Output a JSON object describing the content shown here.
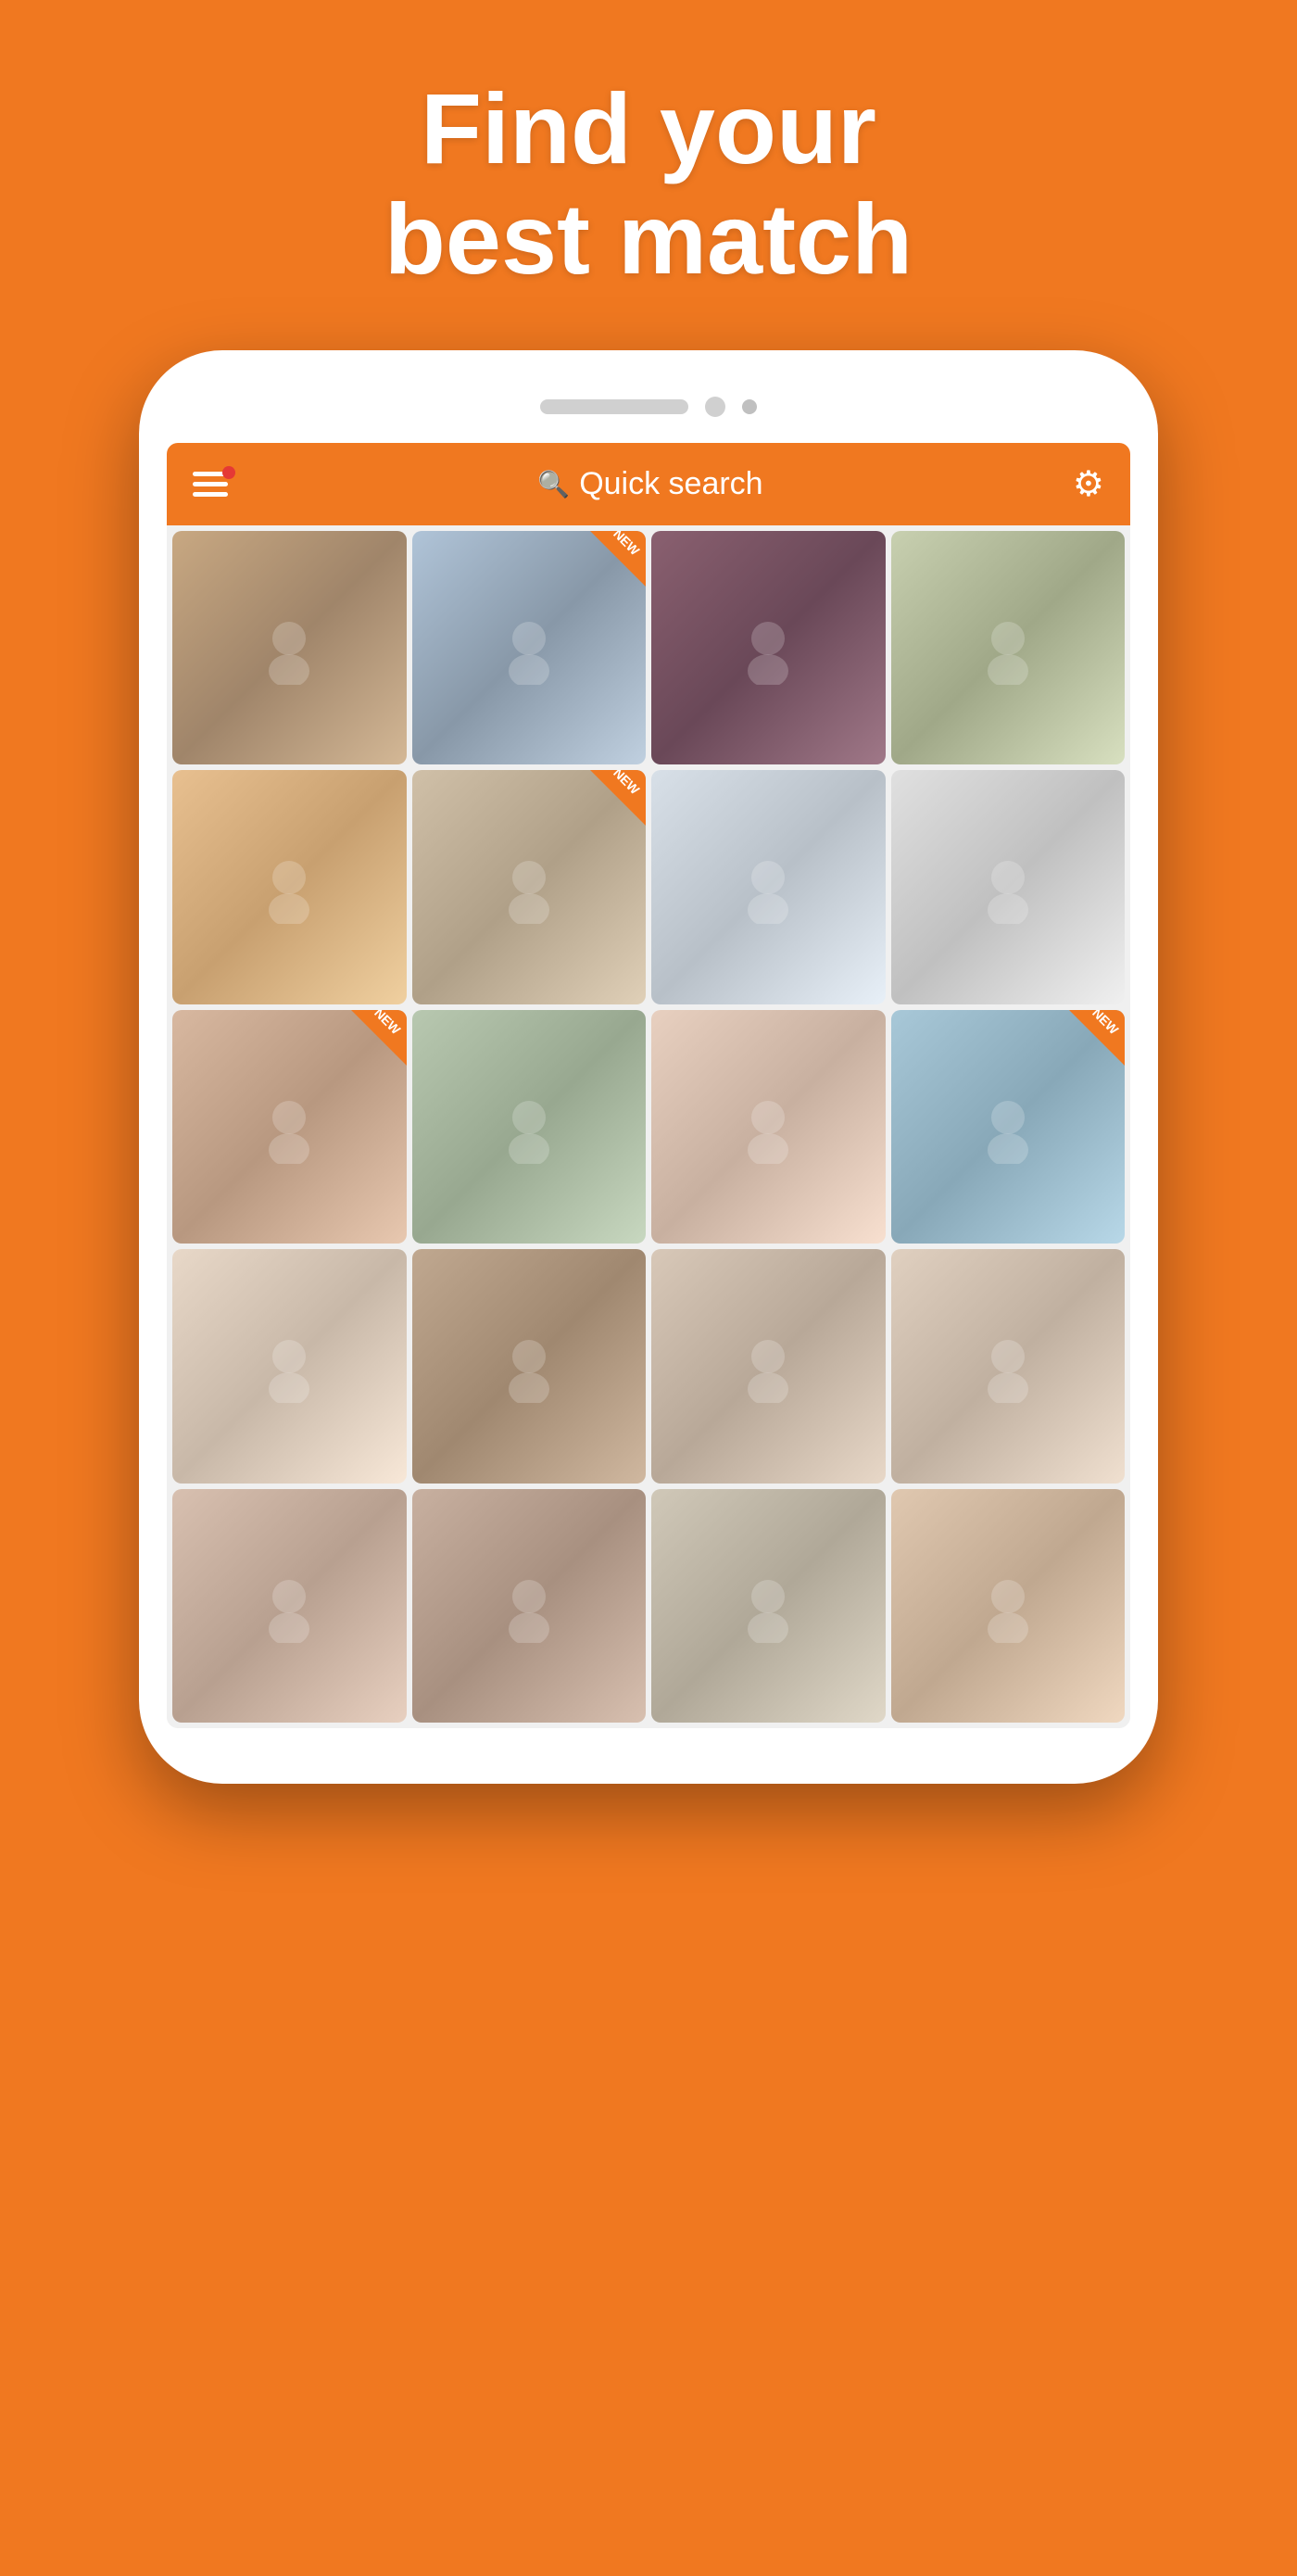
{
  "hero": {
    "line1": "Find your",
    "line2": "best match"
  },
  "header": {
    "search_placeholder": "Quick search",
    "notification_badge": "●"
  },
  "badges": {
    "new_label": "NEW"
  },
  "grid": {
    "items": [
      {
        "id": 1,
        "has_badge": false,
        "photo_class": "photo-1"
      },
      {
        "id": 2,
        "has_badge": true,
        "photo_class": "photo-2"
      },
      {
        "id": 3,
        "has_badge": false,
        "photo_class": "photo-3"
      },
      {
        "id": 4,
        "has_badge": false,
        "photo_class": "photo-4"
      },
      {
        "id": 5,
        "has_badge": false,
        "photo_class": "photo-5"
      },
      {
        "id": 6,
        "has_badge": true,
        "photo_class": "photo-6"
      },
      {
        "id": 7,
        "has_badge": false,
        "photo_class": "photo-7"
      },
      {
        "id": 8,
        "has_badge": false,
        "photo_class": "photo-8"
      },
      {
        "id": 9,
        "has_badge": true,
        "photo_class": "photo-9"
      },
      {
        "id": 10,
        "has_badge": false,
        "photo_class": "photo-10"
      },
      {
        "id": 11,
        "has_badge": false,
        "photo_class": "photo-11"
      },
      {
        "id": 12,
        "has_badge": true,
        "photo_class": "photo-12"
      },
      {
        "id": 13,
        "has_badge": false,
        "photo_class": "photo-13"
      },
      {
        "id": 14,
        "has_badge": false,
        "photo_class": "photo-14"
      },
      {
        "id": 15,
        "has_badge": false,
        "photo_class": "photo-15"
      },
      {
        "id": 16,
        "has_badge": false,
        "photo_class": "photo-16"
      },
      {
        "id": 17,
        "has_badge": false,
        "photo_class": "photo-17"
      },
      {
        "id": 18,
        "has_badge": false,
        "photo_class": "photo-18"
      },
      {
        "id": 19,
        "has_badge": false,
        "photo_class": "photo-19"
      },
      {
        "id": 20,
        "has_badge": false,
        "photo_class": "photo-20"
      }
    ]
  }
}
